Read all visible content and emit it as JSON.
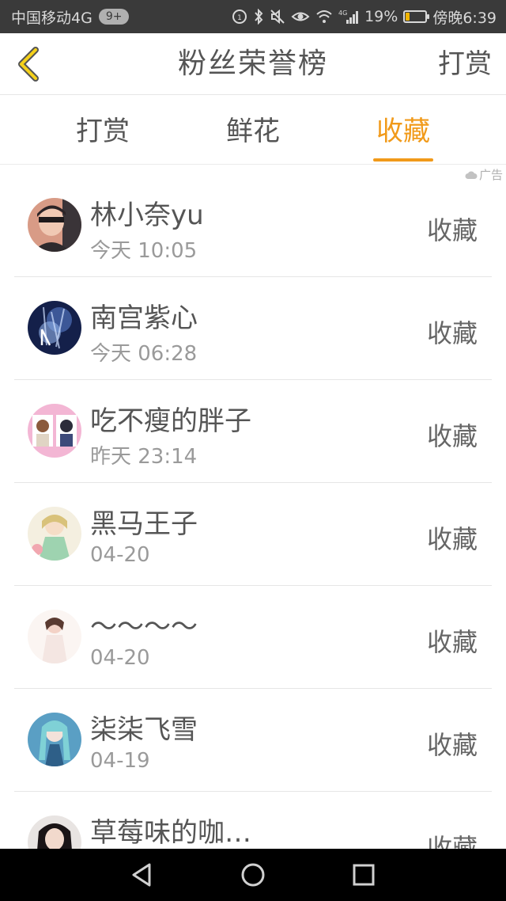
{
  "status_bar": {
    "carrier": "中国移动4G",
    "badge": "9+",
    "battery_pct": "19%",
    "battery_level": 0.19,
    "time": "傍晚6:39",
    "net_label": "4G"
  },
  "header": {
    "title": "粉丝荣誉榜",
    "right_action": "打赏"
  },
  "tabs": [
    {
      "label": "打赏",
      "active": false
    },
    {
      "label": "鲜花",
      "active": false
    },
    {
      "label": "收藏",
      "active": true
    }
  ],
  "ad_tag": "广告",
  "accent_color": "#f19a1a",
  "list": [
    {
      "name": "林小奈yu",
      "time": "今天  10:05",
      "kind": "收藏"
    },
    {
      "name": "南宫紫心",
      "time": "今天  06:28",
      "kind": "收藏"
    },
    {
      "name": "吃不瘦的胖子",
      "time": "昨天  23:14",
      "kind": "收藏"
    },
    {
      "name": "黑马王子",
      "time": "04-20",
      "kind": "收藏"
    },
    {
      "name": "～～～～",
      "time": "04-20",
      "kind": "收藏"
    },
    {
      "name": "柒柒飞雪",
      "time": "04-19",
      "kind": "收藏"
    },
    {
      "name": "草莓味的咖…",
      "time": "",
      "kind": "收藏"
    }
  ]
}
